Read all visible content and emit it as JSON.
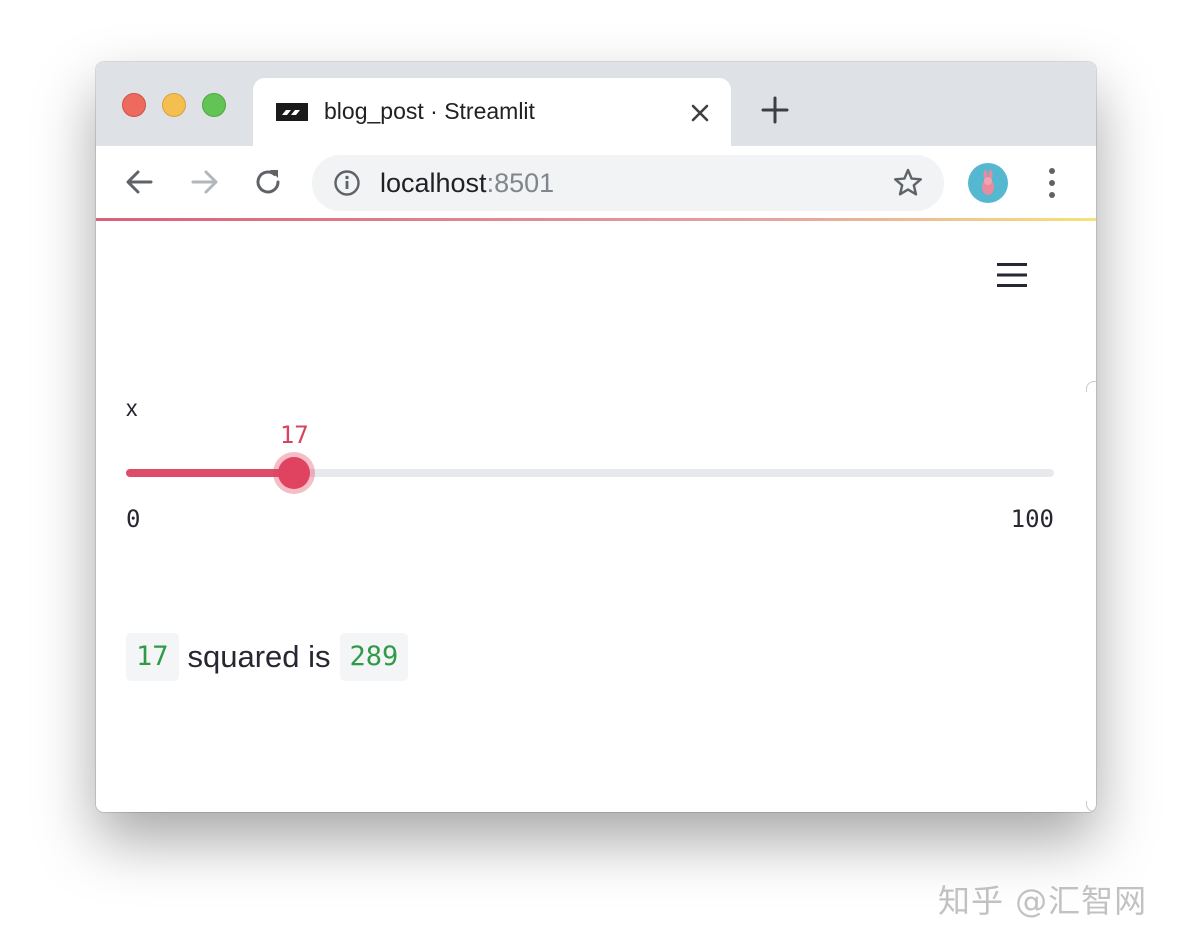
{
  "browser": {
    "tab": {
      "title": "blog_post · Streamlit",
      "favicon": "streamlit-logo"
    },
    "address_bar": {
      "host": "localhost",
      "port": ":8501"
    },
    "icons": {
      "back": "arrow-left-icon",
      "forward": "arrow-right-icon",
      "reload": "reload-icon",
      "site_info": "info-icon",
      "bookmark": "star-icon",
      "menu": "kebab-menu-icon",
      "new_tab": "plus-icon",
      "close_tab": "close-icon"
    },
    "colors": {
      "tabstrip": "#dee1e6",
      "accent_gradient_start": "#d9607a",
      "accent_gradient_end": "#f6e27a"
    }
  },
  "app": {
    "menu_icon": "hamburger-icon",
    "slider": {
      "label": "x",
      "value": "17",
      "value_num": 17,
      "min": "0",
      "max": "100",
      "min_num": 0,
      "max_num": 100,
      "accent_color": "#de4c67"
    },
    "result": {
      "input_value": "17",
      "text": "squared is",
      "output_value": "289",
      "code_color": "#2f9b47"
    }
  },
  "watermark": "知乎 @汇智网"
}
